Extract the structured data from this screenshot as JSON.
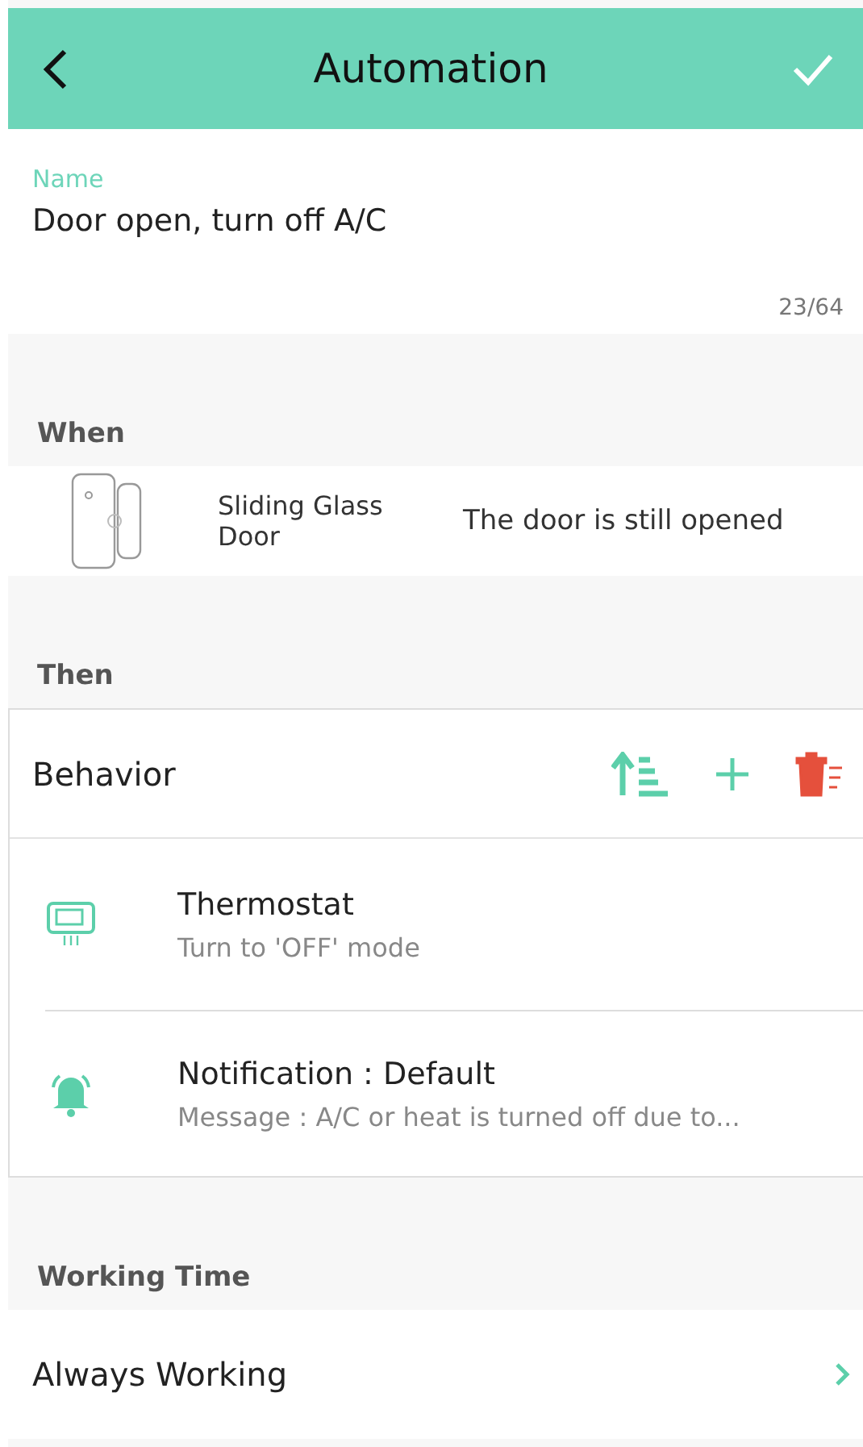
{
  "header": {
    "title": "Automation"
  },
  "name_field": {
    "label": "Name",
    "value": "Door open, turn off A/C",
    "counter": "23/64"
  },
  "when": {
    "heading": "When",
    "device": "Sliding Glass Door",
    "condition": "The door is still opened"
  },
  "then": {
    "heading": "Then",
    "title": "Behavior",
    "actions": [
      {
        "kind": "thermostat",
        "title": "Thermostat",
        "detail": "Turn to 'OFF' mode"
      },
      {
        "kind": "notification",
        "title": "Notification : Default",
        "detail": "Message : A/C or heat is turned off due to..."
      }
    ]
  },
  "working_time": {
    "heading": "Working Time",
    "value": "Always Working"
  }
}
